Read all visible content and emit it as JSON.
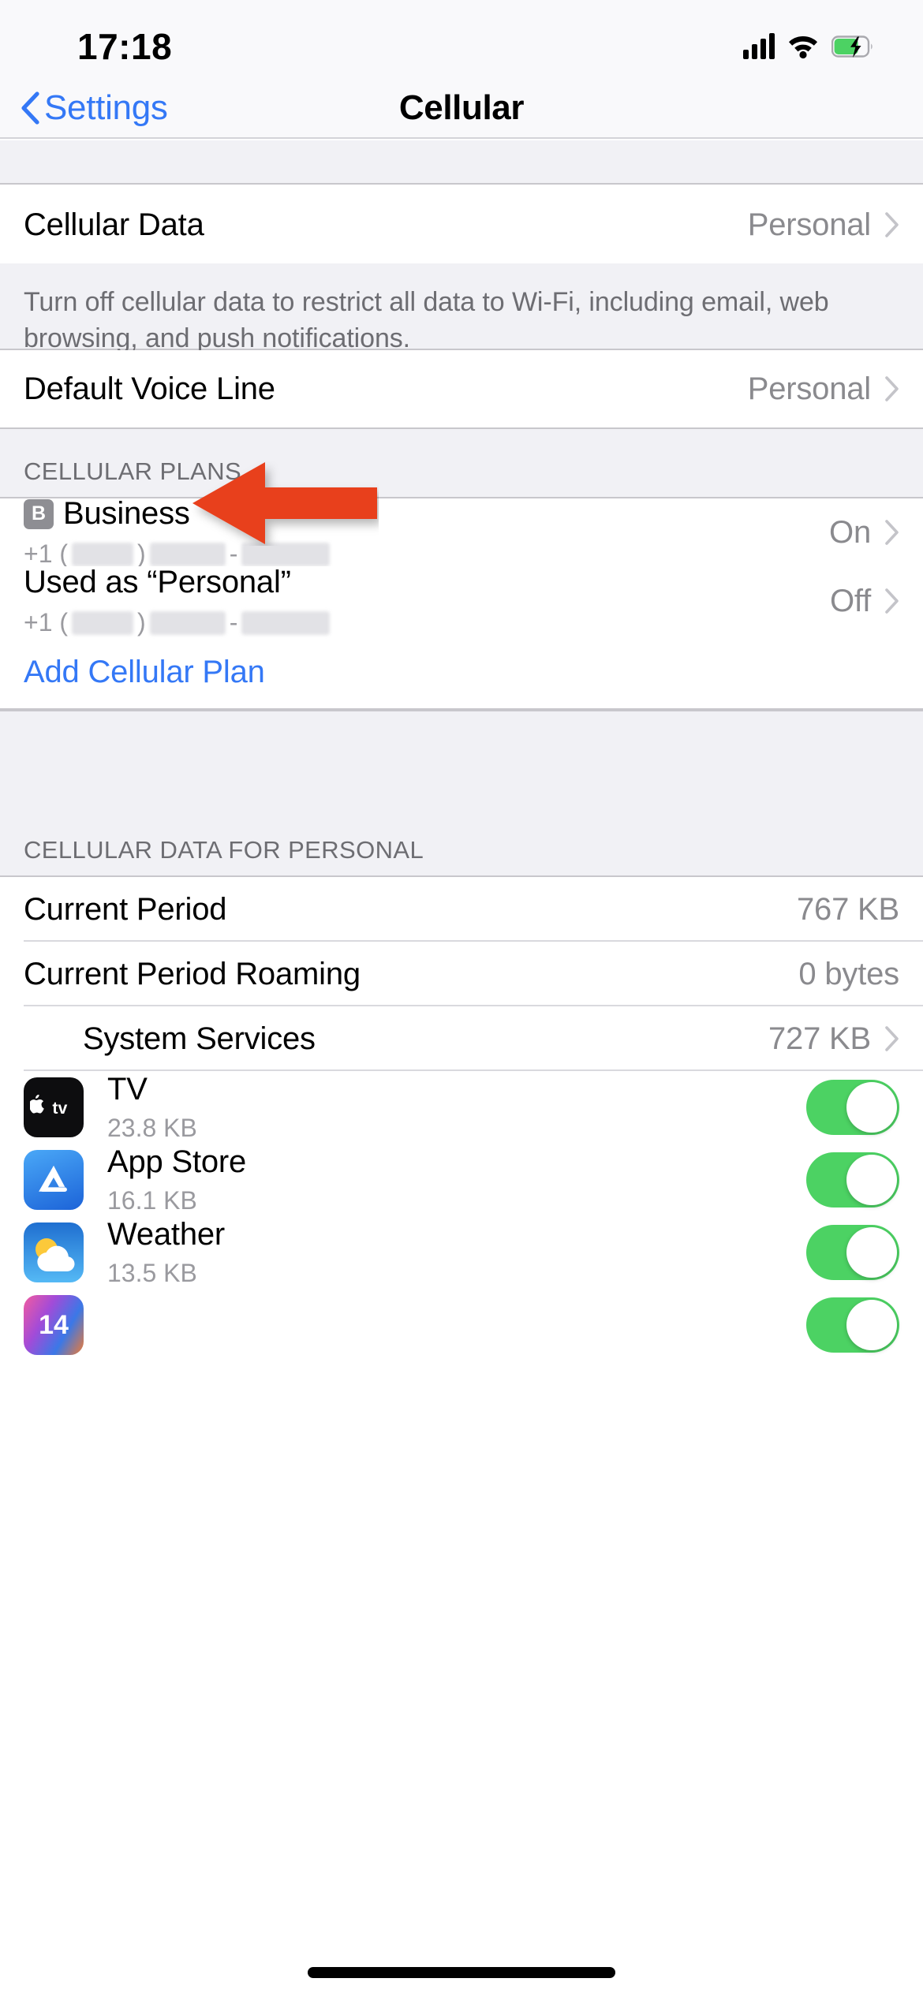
{
  "status_bar": {
    "time": "17:18",
    "signal_icon": "cellular-signal-icon",
    "wifi_icon": "wifi-icon",
    "battery_icon": "battery-charging-icon"
  },
  "nav": {
    "back_label": "Settings",
    "title": "Cellular"
  },
  "cellular_data": {
    "label": "Cellular Data",
    "value": "Personal",
    "footer": "Turn off cellular data to restrict all data to Wi-Fi, including email, web browsing, and push notifications."
  },
  "default_voice_line": {
    "label": "Default Voice Line",
    "value": "Personal"
  },
  "cellular_plans": {
    "header": "CELLULAR PLANS",
    "plans": [
      {
        "badge": "B",
        "title": "Business",
        "number_prefix": "+1 (",
        "number_mid": ")",
        "number_dash": "-",
        "value": "On"
      },
      {
        "badge": "",
        "title": "Used as “Personal”",
        "number_prefix": "+1 (",
        "number_mid": ")",
        "number_dash": "-",
        "value": "Off"
      }
    ],
    "add_plan_label": "Add Cellular Plan"
  },
  "usage": {
    "header": "CELLULAR DATA FOR PERSONAL",
    "rows": [
      {
        "label": "Current Period",
        "value": "767 KB",
        "chevron": false
      },
      {
        "label": "Current Period Roaming",
        "value": "0 bytes",
        "chevron": false
      },
      {
        "label": "System Services",
        "value": "727 KB",
        "chevron": true
      }
    ],
    "apps": [
      {
        "name": "TV",
        "usage": "23.8 KB",
        "icon": "apple-tv-app-icon",
        "enabled": true
      },
      {
        "name": "App Store",
        "usage": "16.1 KB",
        "icon": "app-store-app-icon",
        "enabled": true
      },
      {
        "name": "Weather",
        "usage": "13.5 KB",
        "icon": "weather-app-icon",
        "enabled": true
      },
      {
        "name": "",
        "usage": "",
        "icon": "calendar-app-icon",
        "enabled": true
      }
    ]
  },
  "annotation": {
    "arrow_color": "#e8401f",
    "arrow_name": "red-pointer-arrow"
  },
  "colors": {
    "accent_blue": "#3478f6",
    "toggle_green": "#4cd263",
    "group_bg": "#f1f1f5",
    "secondary_text": "#8a8a8e"
  }
}
